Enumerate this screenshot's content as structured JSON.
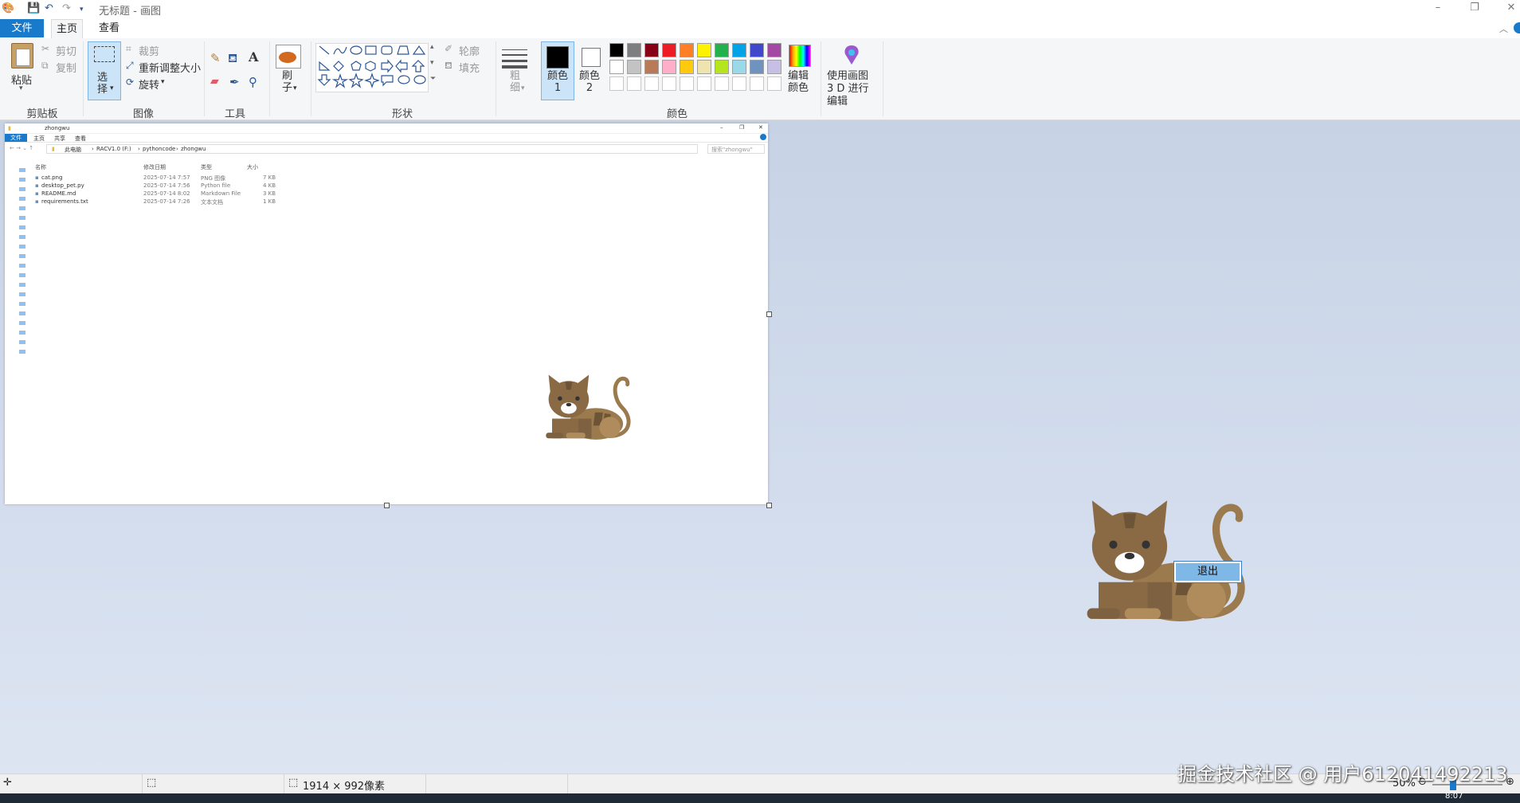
{
  "window": {
    "title": "无标题 - 画图",
    "minimize": "–",
    "restore": "❐",
    "close": "✕"
  },
  "tabs": [
    {
      "label": "文件"
    },
    {
      "label": "主页"
    },
    {
      "label": "查看"
    }
  ],
  "ribbon": {
    "clipboard": {
      "paste": "粘贴",
      "cut": "剪切",
      "copy": "复制",
      "group": "剪贴板"
    },
    "image": {
      "select": "选择",
      "crop": "裁剪",
      "resize": "重新调整大小",
      "rotate": "旋转",
      "group": "图像"
    },
    "tools": {
      "group": "工具"
    },
    "brushes": {
      "label": "刷子"
    },
    "shapes": {
      "outline": "轮廓",
      "fill": "填充",
      "group": "形状"
    },
    "size": {
      "label": "粗细"
    },
    "color1": {
      "label": "颜色 1"
    },
    "color2": {
      "label": "颜色 2"
    },
    "colors_group": "颜色",
    "edit_colors": "编辑颜色",
    "paint3d": "使用画图 3 D 进行编辑"
  },
  "palette": {
    "row1": [
      "#000000",
      "#7f7f7f",
      "#880015",
      "#ed1c24",
      "#ff7f27",
      "#fff200",
      "#22b14c",
      "#00a2e8",
      "#3f48cc",
      "#a349a4"
    ],
    "row2": [
      "#ffffff",
      "#c3c3c3",
      "#b97a57",
      "#ffaec9",
      "#ffc90e",
      "#efe4b0",
      "#b5e61d",
      "#99d9ea",
      "#7092be",
      "#c8bfe7"
    ],
    "row3": [
      "#ffffff",
      "#ffffff",
      "#ffffff",
      "#ffffff",
      "#ffffff",
      "#ffffff",
      "#ffffff",
      "#ffffff",
      "#ffffff",
      "#ffffff"
    ],
    "color1": "#000000",
    "color2": "#ffffff",
    "accent": "#1979ca"
  },
  "explorer": {
    "title": "zhongwu",
    "tabs": [
      "文件",
      "主页",
      "共享",
      "查看"
    ],
    "path": [
      "此电脑",
      "RACV1.0 (F:)",
      "pythoncode",
      "zhongwu"
    ],
    "search_placeholder": "搜索\"zhongwu\"",
    "columns": [
      "名称",
      "修改日期",
      "类型",
      "大小"
    ],
    "files": [
      {
        "name": "cat.png",
        "date": "2025-07-14 7:57",
        "type": "PNG 图像",
        "size": "7 KB"
      },
      {
        "name": "desktop_pet.py",
        "date": "2025-07-14 7:56",
        "type": "Python file",
        "size": "4 KB"
      },
      {
        "name": "README.md",
        "date": "2025-07-14 8:02",
        "type": "Markdown File",
        "size": "3 KB"
      },
      {
        "name": "requirements.txt",
        "date": "2025-07-14 7:26",
        "type": "文本文档",
        "size": "1 KB"
      }
    ]
  },
  "context_menu": {
    "exit": "退出"
  },
  "statusbar": {
    "dimensions": "1914 × 992像素",
    "zoom": "50%"
  },
  "watermark": "掘金技术社区 @ 用户612041492213",
  "clock": "8:07"
}
